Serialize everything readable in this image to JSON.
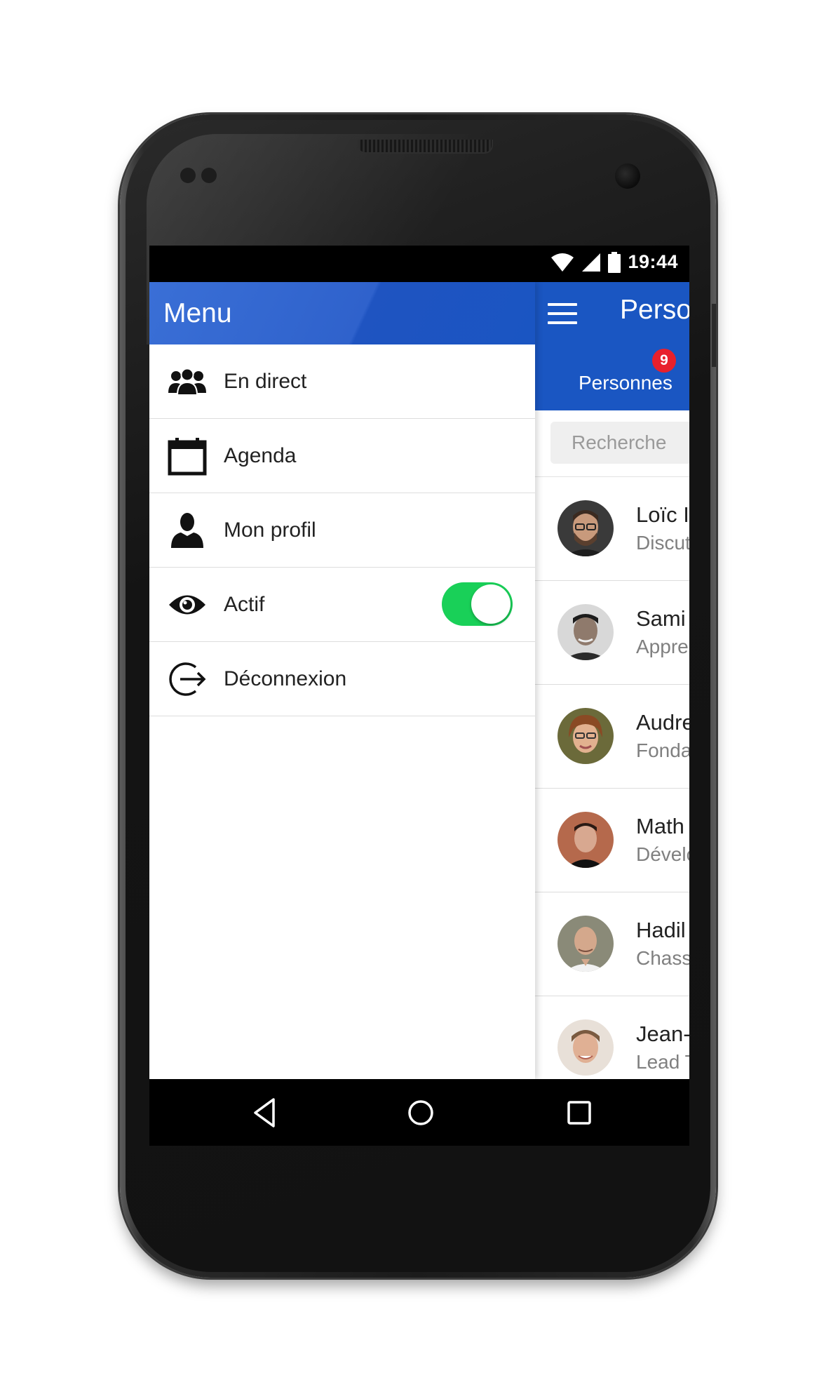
{
  "status_bar": {
    "time": "19:44"
  },
  "drawer": {
    "title": "Menu",
    "items": [
      {
        "label": "En direct",
        "icon": "group-icon"
      },
      {
        "label": "Agenda",
        "icon": "calendar-icon"
      },
      {
        "label": "Mon profil",
        "icon": "person-icon"
      },
      {
        "label": "Actif",
        "icon": "eye-icon",
        "toggle": true
      },
      {
        "label": "Déconnexion",
        "icon": "logout-icon"
      }
    ]
  },
  "main": {
    "title": "Perso",
    "tab": {
      "label": "Personnes",
      "badge": "9"
    },
    "search": {
      "placeholder": "Recherche"
    },
    "people": [
      {
        "name": "Loïc I",
        "subtitle": "Discut"
      },
      {
        "name": "Sami",
        "subtitle": "Appre"
      },
      {
        "name": "Audre",
        "subtitle": "Fonda"
      },
      {
        "name": "Math",
        "subtitle": "Dévelo"
      },
      {
        "name": "Hadil",
        "subtitle": "Chass"
      },
      {
        "name": "Jean-",
        "subtitle": "Lead T"
      }
    ]
  },
  "colors": {
    "primary": "#1a56c2",
    "toggle_on": "#19d058",
    "badge": "#e8202c"
  }
}
